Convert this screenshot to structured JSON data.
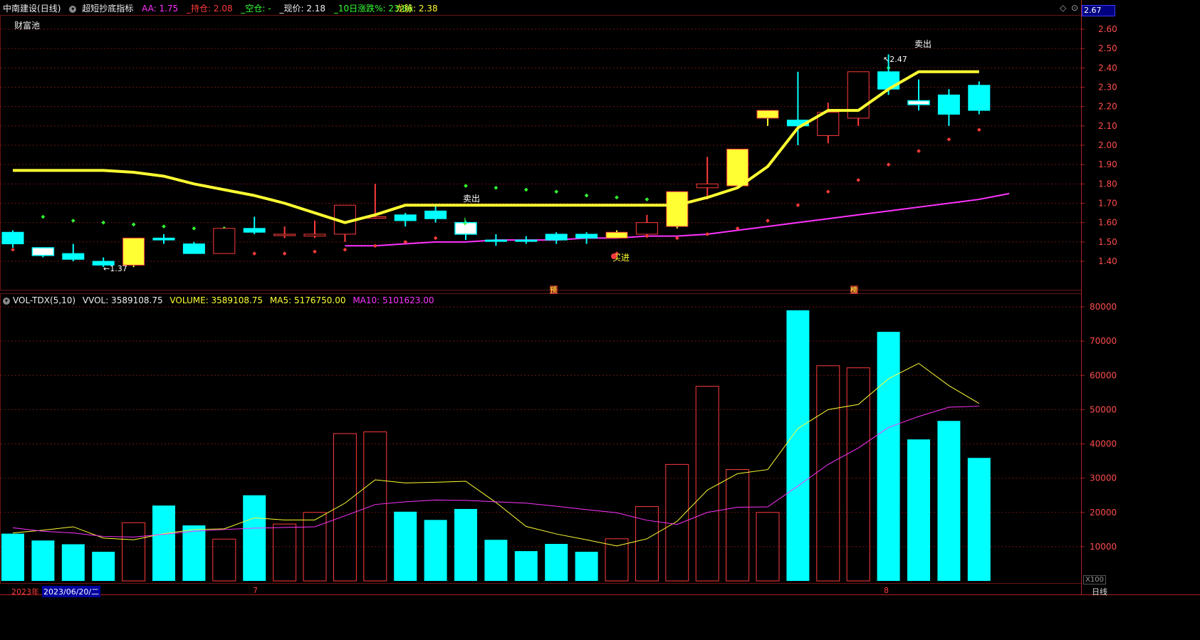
{
  "header": {
    "stock_name": "中南建设",
    "period": "(日线)",
    "indicator": "超短抄底指标",
    "aa_label": "AA: ",
    "aa": "1.75",
    "hold_label": "_持仓: ",
    "hold": "2.08",
    "empty_label": "_空仓: ",
    "empty": "-",
    "price_label": "_现价: ",
    "price": "2.18",
    "chg_label": "_10日涨跌%: ",
    "chg": "23.86",
    "dragon_label": "龙脉: ",
    "dragon": "2.38",
    "wealth_pool": "财富池",
    "current_price_box": "2.67"
  },
  "vol_header": {
    "name": "VOL-TDX(5,10)",
    "vvol": "VVOL: 3589108.75",
    "volume": "VOLUME: 3589108.75",
    "ma5": "MA5: 5176750.00",
    "ma10": "MA10: 5101623.00"
  },
  "annotations": {
    "sell": "卖出",
    "buy": "买进",
    "low_mark": "1.37",
    "high_mark": "2.47",
    "yu": "预",
    "bang": "榜"
  },
  "bottom": {
    "year": "2023年",
    "date": "2023/06/20/二",
    "month7": "7",
    "month8": "8",
    "period_btn": "日线",
    "x100": "X100"
  },
  "colors": {
    "up": "#ff3b3b",
    "down": "#00ffff",
    "yellow": "#ffff33",
    "magenta": "#ff33ff",
    "green": "#33ff33",
    "grid": "#6a1414"
  },
  "chart_data": [
    {
      "type": "candlestick",
      "title": "中南建设 (日线)",
      "ylim": [
        1.3,
        2.67
      ],
      "y_ticks": [
        "2.60",
        "2.50",
        "2.40",
        "2.30",
        "2.20",
        "2.10",
        "2.00",
        "1.90",
        "1.80",
        "1.70",
        "1.60",
        "1.50",
        "1.40"
      ],
      "candles": [
        {
          "o": 1.49,
          "c": 1.55,
          "h": 1.56,
          "l": 1.47,
          "color": "down"
        },
        {
          "o": 1.47,
          "c": 1.43,
          "h": 1.47,
          "l": 1.42,
          "color": "down-white"
        },
        {
          "o": 1.44,
          "c": 1.41,
          "h": 1.49,
          "l": 1.4,
          "color": "down"
        },
        {
          "o": 1.4,
          "c": 1.38,
          "h": 1.42,
          "l": 1.37,
          "color": "down"
        },
        {
          "o": 1.38,
          "c": 1.52,
          "h": 1.52,
          "l": 1.37,
          "color": "yellow"
        },
        {
          "o": 1.51,
          "c": 1.52,
          "h": 1.54,
          "l": 1.49,
          "color": "down"
        },
        {
          "o": 1.49,
          "c": 1.44,
          "h": 1.5,
          "l": 1.44,
          "color": "down"
        },
        {
          "o": 1.44,
          "c": 1.57,
          "h": 1.57,
          "l": 1.44,
          "color": "up"
        },
        {
          "o": 1.57,
          "c": 1.55,
          "h": 1.63,
          "l": 1.54,
          "color": "down"
        },
        {
          "o": 1.54,
          "c": 1.54,
          "h": 1.58,
          "l": 1.52,
          "color": "up"
        },
        {
          "o": 1.53,
          "c": 1.54,
          "h": 1.61,
          "l": 1.52,
          "color": "up"
        },
        {
          "o": 1.54,
          "c": 1.69,
          "h": 1.69,
          "l": 1.5,
          "color": "up"
        },
        {
          "o": 1.63,
          "c": 1.63,
          "h": 1.8,
          "l": 1.62,
          "color": "up"
        },
        {
          "o": 1.61,
          "c": 1.64,
          "h": 1.65,
          "l": 1.58,
          "color": "down"
        },
        {
          "o": 1.62,
          "c": 1.66,
          "h": 1.69,
          "l": 1.6,
          "color": "down"
        },
        {
          "o": 1.6,
          "c": 1.54,
          "h": 1.61,
          "l": 1.51,
          "color": "down-white"
        },
        {
          "o": 1.51,
          "c": 1.51,
          "h": 1.54,
          "l": 1.48,
          "color": "down"
        },
        {
          "o": 1.51,
          "c": 1.51,
          "h": 1.53,
          "l": 1.49,
          "color": "down"
        },
        {
          "o": 1.54,
          "c": 1.51,
          "h": 1.55,
          "l": 1.49,
          "color": "down"
        },
        {
          "o": 1.54,
          "c": 1.52,
          "h": 1.55,
          "l": 1.49,
          "color": "down"
        },
        {
          "o": 1.52,
          "c": 1.55,
          "h": 1.56,
          "l": 1.52,
          "color": "yellow"
        },
        {
          "o": 1.54,
          "c": 1.6,
          "h": 1.64,
          "l": 1.53,
          "color": "up"
        },
        {
          "o": 1.58,
          "c": 1.76,
          "h": 1.76,
          "l": 1.57,
          "color": "yellow"
        },
        {
          "o": 1.78,
          "c": 1.8,
          "h": 1.94,
          "l": 1.72,
          "color": "up"
        },
        {
          "o": 1.79,
          "c": 1.98,
          "h": 1.98,
          "l": 1.78,
          "color": "yellow"
        },
        {
          "o": 2.14,
          "c": 2.18,
          "h": 2.18,
          "l": 2.1,
          "color": "yellow"
        },
        {
          "o": 2.13,
          "c": 2.1,
          "h": 2.38,
          "l": 2.0,
          "color": "down"
        },
        {
          "o": 2.05,
          "c": 2.17,
          "h": 2.22,
          "l": 2.01,
          "color": "up"
        },
        {
          "o": 2.14,
          "c": 2.38,
          "h": 2.38,
          "l": 2.1,
          "color": "up"
        },
        {
          "o": 2.38,
          "c": 2.29,
          "h": 2.47,
          "l": 2.26,
          "color": "down"
        },
        {
          "o": 2.23,
          "c": 2.21,
          "h": 2.34,
          "l": 2.18,
          "color": "down-white"
        },
        {
          "o": 2.16,
          "c": 2.26,
          "h": 2.29,
          "l": 2.1,
          "color": "down"
        },
        {
          "o": 2.18,
          "c": 2.31,
          "h": 2.33,
          "l": 2.16,
          "color": "down"
        }
      ],
      "dragon_line": [
        1.87,
        1.87,
        1.87,
        1.87,
        1.86,
        1.84,
        1.8,
        1.77,
        1.74,
        1.7,
        1.65,
        1.6,
        1.64,
        1.69,
        1.69,
        1.69,
        1.69,
        1.69,
        1.69,
        1.69,
        1.69,
        1.69,
        1.69,
        1.73,
        1.78,
        1.89,
        2.09,
        2.18,
        2.18,
        2.29,
        2.38,
        2.38,
        2.38
      ],
      "dragon_start": 0,
      "magenta_line_start": 11,
      "magenta_line": [
        1.48,
        1.48,
        1.49,
        1.5,
        1.5,
        1.51,
        1.51,
        1.51,
        1.52,
        1.52,
        1.53,
        1.53,
        1.54,
        1.56,
        1.58,
        1.6,
        1.62,
        1.64,
        1.66,
        1.68,
        1.7,
        1.72,
        1.75
      ],
      "green_dots": [
        {
          "i": 1,
          "v": 1.63
        },
        {
          "i": 2,
          "v": 1.61
        },
        {
          "i": 3,
          "v": 1.6
        },
        {
          "i": 4,
          "v": 1.59
        },
        {
          "i": 5,
          "v": 1.58
        },
        {
          "i": 6,
          "v": 1.57
        },
        {
          "i": 7,
          "v": 1.57
        },
        {
          "i": 15,
          "v": 1.79
        },
        {
          "i": 16,
          "v": 1.78
        },
        {
          "i": 17,
          "v": 1.77
        },
        {
          "i": 18,
          "v": 1.76
        },
        {
          "i": 19,
          "v": 1.74
        },
        {
          "i": 20,
          "v": 1.73
        },
        {
          "i": 21,
          "v": 1.72
        },
        {
          "i": 29,
          "v": 2.4
        }
      ],
      "red_dots": [
        {
          "i": 0,
          "v": 1.46
        },
        {
          "i": 8,
          "v": 1.44
        },
        {
          "i": 9,
          "v": 1.44
        },
        {
          "i": 10,
          "v": 1.45
        },
        {
          "i": 11,
          "v": 1.46
        },
        {
          "i": 12,
          "v": 1.48
        },
        {
          "i": 13,
          "v": 1.5
        },
        {
          "i": 14,
          "v": 1.52
        },
        {
          "i": 20,
          "v": 1.44
        },
        {
          "i": 21,
          "v": 1.53
        },
        {
          "i": 22,
          "v": 1.52
        },
        {
          "i": 23,
          "v": 1.54
        },
        {
          "i": 24,
          "v": 1.57
        },
        {
          "i": 25,
          "v": 1.61
        },
        {
          "i": 26,
          "v": 1.69
        },
        {
          "i": 27,
          "v": 1.76
        },
        {
          "i": 28,
          "v": 1.82
        },
        {
          "i": 29,
          "v": 1.9
        },
        {
          "i": 30,
          "v": 1.97
        },
        {
          "i": 31,
          "v": 2.03
        },
        {
          "i": 32,
          "v": 2.08
        }
      ]
    },
    {
      "type": "bar",
      "title": "VOL-TDX(5,10)",
      "ylim": [
        0,
        82000
      ],
      "y_ticks": [
        "80000",
        "70000",
        "60000",
        "50000",
        "40000",
        "30000",
        "20000",
        "10000"
      ],
      "volumes": [
        13800,
        11800,
        10700,
        8500,
        17000,
        22000,
        16200,
        12200,
        25000,
        16600,
        20000,
        43000,
        43500,
        20200,
        17800,
        21000,
        12000,
        8700,
        10800,
        8500,
        12300,
        21700,
        34000,
        56800,
        32500,
        20000,
        79000,
        62800,
        62200,
        72700,
        41300,
        46700,
        35900
      ],
      "ma5": [
        14000,
        14800,
        15800,
        12500,
        12000,
        13800,
        15000,
        15200,
        18400,
        17800,
        17800,
        22700,
        29500,
        28600,
        28800,
        29100,
        22900,
        15900,
        13700,
        12000,
        10200,
        12300,
        17400,
        26500,
        31300,
        32500,
        44500,
        50000,
        51500,
        59000,
        63500,
        57000,
        51800
      ],
      "ma10": [
        15500,
        14500,
        14000,
        13000,
        12800,
        13600,
        14500,
        15000,
        15400,
        15600,
        15800,
        19000,
        22300,
        23100,
        23600,
        23500,
        23100,
        22700,
        21800,
        20800,
        19900,
        17700,
        16500,
        20000,
        21500,
        21600,
        27700,
        34000,
        38800,
        44800,
        48000,
        50700,
        51000
      ]
    }
  ]
}
